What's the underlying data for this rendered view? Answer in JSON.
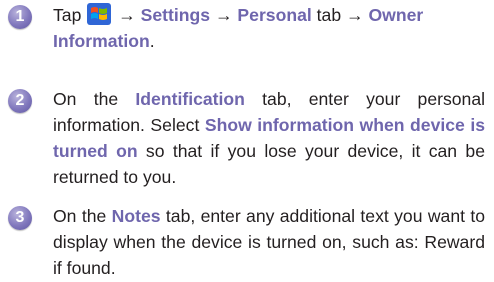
{
  "steps": [
    {
      "number": "1",
      "tap": "Tap",
      "arrow1": "→",
      "settings": "Settings",
      "arrow2": "→",
      "personal": "Personal",
      "tab_word": "tab",
      "arrow3": "→",
      "owner_info_line1": "Owner",
      "owner_info_line2": "Information",
      "period": "."
    },
    {
      "number": "2",
      "on_the": "On the",
      "identification": "Identification",
      "tab_rest": "tab, enter your personal information. Select",
      "show_info": "Show information when device is turned on",
      "rest": "so that if you lose your device, it can be returned to you."
    },
    {
      "number": "3",
      "on_the": "On the",
      "notes": "Notes",
      "rest": "tab, enter any additional text you want to display when the device is turned on, such as: Reward if found."
    }
  ],
  "icons": {
    "start_icon": "windows-start-flag-icon"
  },
  "colors": {
    "badge": "#7d74b9",
    "keyword": "#6f66ad",
    "text": "#231f20"
  }
}
